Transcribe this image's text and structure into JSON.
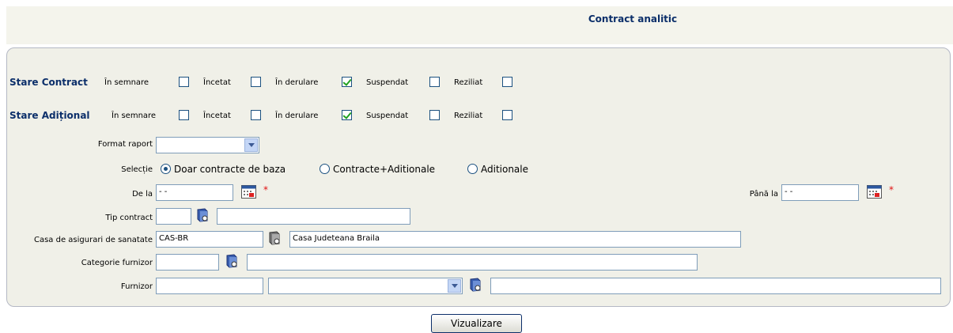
{
  "title": "Contract analitic",
  "stare_contract": {
    "label": "Stare Contract",
    "options": [
      {
        "label": "În semnare",
        "checked": false
      },
      {
        "label": "Încetat",
        "checked": false
      },
      {
        "label": "În derulare",
        "checked": true
      },
      {
        "label": "Suspendat",
        "checked": false
      },
      {
        "label": "Reziliat",
        "checked": false
      }
    ]
  },
  "stare_aditional": {
    "label": "Stare Adițional",
    "options": [
      {
        "label": "În semnare",
        "checked": false
      },
      {
        "label": "Încetat",
        "checked": false
      },
      {
        "label": "În derulare",
        "checked": true
      },
      {
        "label": "Suspendat",
        "checked": false
      },
      {
        "label": "Reziliat",
        "checked": false
      }
    ]
  },
  "format_raport": {
    "label": "Format raport",
    "value": ""
  },
  "selectie": {
    "label": "Selecție",
    "options": [
      {
        "label": "Doar contracte de baza",
        "selected": true
      },
      {
        "label": "Contracte+Aditionale",
        "selected": false
      },
      {
        "label": "Aditionale",
        "selected": false
      }
    ]
  },
  "de_la": {
    "label": "De la",
    "value": "  -  -"
  },
  "pana_la": {
    "label": "Până la",
    "value": "  -  -"
  },
  "tip_contract": {
    "label": "Tip contract",
    "code": "",
    "name": ""
  },
  "casa": {
    "label": "Casa de asigurari de sanatate",
    "code": "CAS-BR",
    "name": "Casa Judeteana Braila"
  },
  "categorie_furnizor": {
    "label": "Categorie furnizor",
    "code": "",
    "name": ""
  },
  "furnizor": {
    "label": "Furnizor",
    "code": "",
    "select": "",
    "name": ""
  },
  "required_mark": "*",
  "button": {
    "label": "Vizualizare"
  },
  "icons": {
    "lookup": "lookup-book-icon",
    "calendar": "calendar-icon",
    "dropdown": "chevron-down-icon"
  }
}
